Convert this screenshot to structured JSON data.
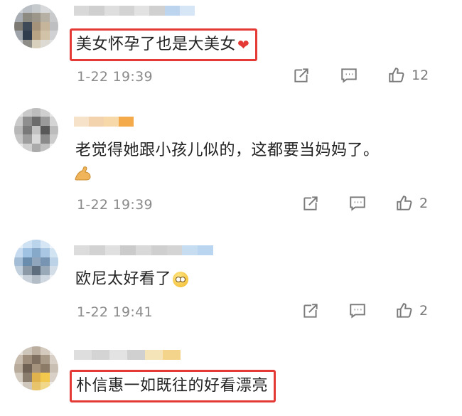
{
  "comments": [
    {
      "text": "美女怀孕了也是大美女",
      "emoji": "heart",
      "time": "1-22 19:39",
      "likes": "12",
      "highlighted": true
    },
    {
      "text": "老觉得她跟小孩儿似的，这都要当妈妈了。",
      "emoji": "muscle",
      "time": "1-22 19:39",
      "likes": "2",
      "highlighted": false
    },
    {
      "text": "欧尼太好看了",
      "emoji": "pleading-face",
      "time": "1-22 19:41",
      "likes": "2",
      "highlighted": false
    },
    {
      "text": "朴信惠一如既往的好看漂亮",
      "emoji": "",
      "time": "",
      "likes": "",
      "highlighted": true
    }
  ],
  "icons": {
    "share": "share-icon",
    "comment": "comment-icon",
    "like": "thumbs-up-icon"
  },
  "colors": {
    "highlight": "#e53935",
    "meta": "#8a8a8a"
  }
}
